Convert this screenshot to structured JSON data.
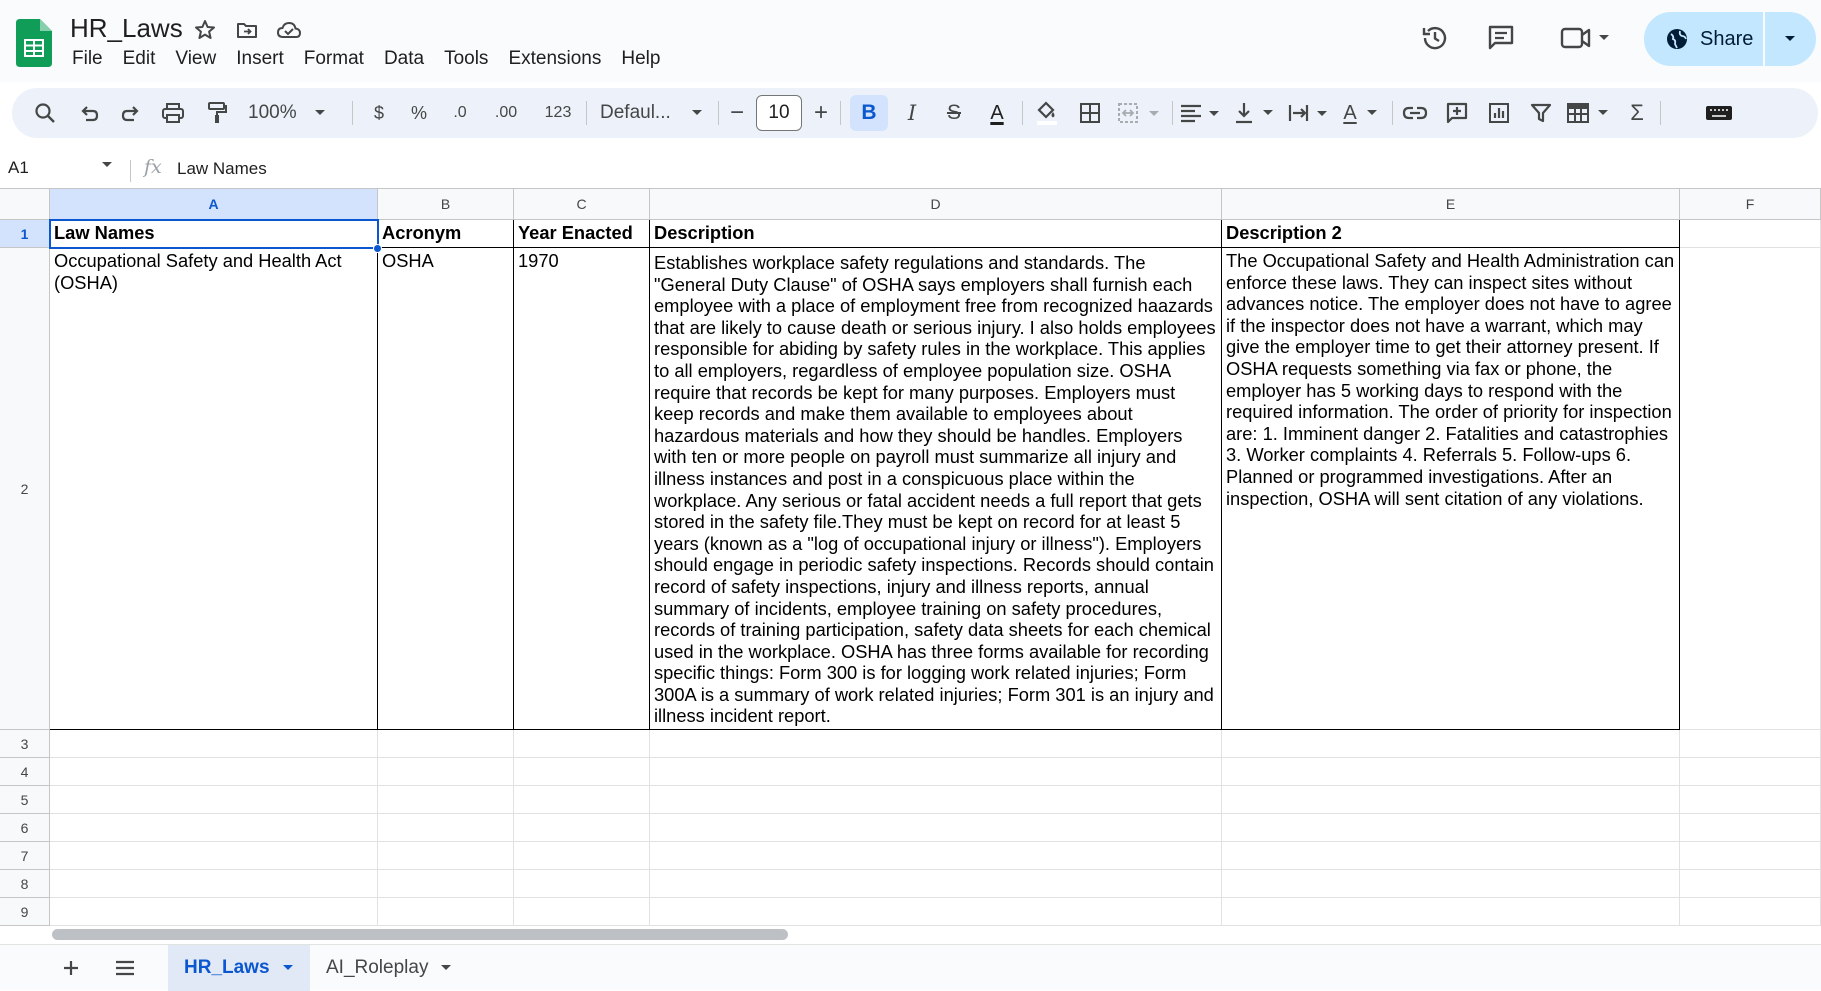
{
  "app": {
    "title": "HR_Laws",
    "menus": [
      "File",
      "Edit",
      "View",
      "Insert",
      "Format",
      "Data",
      "Tools",
      "Extensions",
      "Help"
    ],
    "share_label": "Share"
  },
  "toolbar": {
    "zoom": "100%",
    "currency": "$",
    "percent": "%",
    "decrease_decimal": ".0",
    "increase_decimal": ".00",
    "more_formats": "123",
    "font": "Defaul...",
    "font_size": "10",
    "minus": "−",
    "plus": "+",
    "bold": "B",
    "italic": "I",
    "strikethrough": "S",
    "text_color_letter": "A",
    "rotate_letter": "A",
    "function": "Σ"
  },
  "formula_bar": {
    "cell_ref": "A1",
    "fx": "fx",
    "value": "Law Names"
  },
  "grid": {
    "columns": [
      "A",
      "B",
      "C",
      "D",
      "E",
      "F"
    ],
    "row_numbers": [
      "1",
      "2",
      "3",
      "4",
      "5",
      "6",
      "7",
      "8",
      "9"
    ],
    "header_row": [
      "Law Names",
      "Acronym",
      "Year Enacted",
      "Description",
      "Description 2"
    ],
    "data_row": {
      "law_name": "Occupational Safety and Health Act (OSHA)",
      "acronym": "OSHA",
      "year": "1970",
      "description": "Establishes workplace safety regulations and standards. The \"General Duty Clause\" of OSHA says employers shall furnish each employee with a place of employment free from recognized haazards that are likely to cause death or serious injury. I also holds employees responsible for abiding by safety rules in the workplace. This applies to all employers, regardless of employee population size. OSHA require that records be kept for many purposes. Employers must keep records and make them available to employees about hazardous materials and how they should be handles. Employers with ten or more people on payroll must summarize all injury and illness instances and post in a conspicuous place within the workplace. Any serious or fatal accident needs a full report that gets stored in the safety file.They must be kept on record for at least 5 years (known as a \"log of occupational injury or illness\"). Employers should engage in periodic safety inspections. Records should contain record of safety inspections, injury and illness reports, annual summary of incidents, employee training on safety procedures, records of training participation, safety data sheets for each chemical used in the workplace. OSHA has three forms available for recording specific things: Form 300 is for logging work related injuries; Form 300A is a summary of work related injuries; Form 301 is an injury and illness incident report.",
      "description2": "The Occupational Safety and Health Administration can enforce these laws. They can inspect sites without advances notice. The employer does not have to agree if the inspector does not have a warrant, which may give the employer time to get their attorney present. If OSHA requests something via fax or phone, the employer has 5 working days to respond with the required information. The order of priority for inspection are: 1. Imminent danger 2. Fatalities and catastrophies 3. Worker complaints 4. Referrals 5. Follow-ups 6. Planned or programmed investigations. After an inspection, OSHA will sent citation of any violations."
    }
  },
  "sheets": [
    {
      "name": "HR_Laws",
      "active": true
    },
    {
      "name": "AI_Roleplay",
      "active": false
    }
  ],
  "colors": {
    "accent": "#0b57d0",
    "share_bg": "#c2e7ff",
    "toolbar_bg": "#edf2fa",
    "selected_header_bg": "#d3e3fd",
    "sheets_green": "#0f9d58"
  }
}
